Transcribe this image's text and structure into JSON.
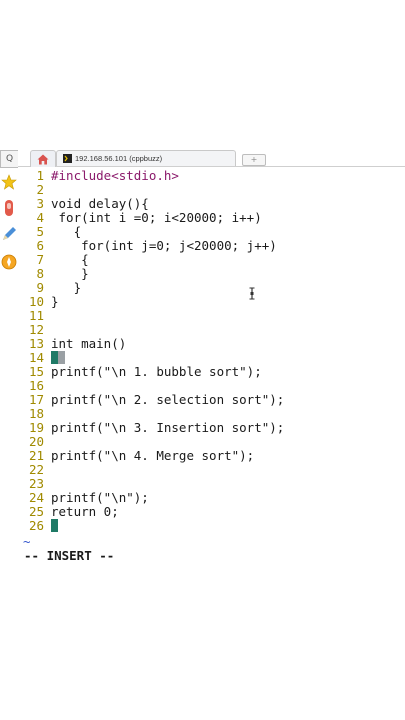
{
  "browser": {
    "tab_title": "192.168.56.101 (cppbuzz)",
    "new_tab_glyph": "+"
  },
  "dock": {
    "search_glyph": "Q",
    "icons": [
      "star-icon",
      "remote-icon",
      "pencil-icon",
      "compass-icon"
    ]
  },
  "editor": {
    "lines": [
      {
        "n": "1",
        "text": "#include<stdio.h>"
      },
      {
        "n": "2",
        "text": ""
      },
      {
        "n": "3",
        "text": "void delay(){"
      },
      {
        "n": "4",
        "text": " for(int i =0; i<20000; i++)"
      },
      {
        "n": "5",
        "text": "   {"
      },
      {
        "n": "6",
        "text": "    for(int j=0; j<20000; j++)"
      },
      {
        "n": "7",
        "text": "    {"
      },
      {
        "n": "8",
        "text": "    }"
      },
      {
        "n": "9",
        "text": "   }"
      },
      {
        "n": "10",
        "text": "}"
      },
      {
        "n": "11",
        "text": ""
      },
      {
        "n": "12",
        "text": ""
      },
      {
        "n": "13",
        "text": "int main()"
      },
      {
        "n": "14",
        "text": ""
      },
      {
        "n": "15",
        "text": "printf(\"\\n 1. bubble sort\");"
      },
      {
        "n": "16",
        "text": ""
      },
      {
        "n": "17",
        "text": "printf(\"\\n 2. selection sort\");"
      },
      {
        "n": "18",
        "text": ""
      },
      {
        "n": "19",
        "text": "printf(\"\\n 3. Insertion sort\");"
      },
      {
        "n": "20",
        "text": ""
      },
      {
        "n": "21",
        "text": "printf(\"\\n 4. Merge sort\");"
      },
      {
        "n": "22",
        "text": ""
      },
      {
        "n": "23",
        "text": ""
      },
      {
        "n": "24",
        "text": "printf(\"\\n\");"
      },
      {
        "n": "25",
        "text": "return 0;"
      },
      {
        "n": "26",
        "text": ""
      }
    ],
    "tilde": "~",
    "mode": "-- INSERT --"
  },
  "colors": {
    "line_number": "#a08a00",
    "keyword": "#2a7d2a",
    "preprocessor": "#8b1a6b",
    "string": "#c0392b",
    "cursor": "#1f7a66"
  }
}
